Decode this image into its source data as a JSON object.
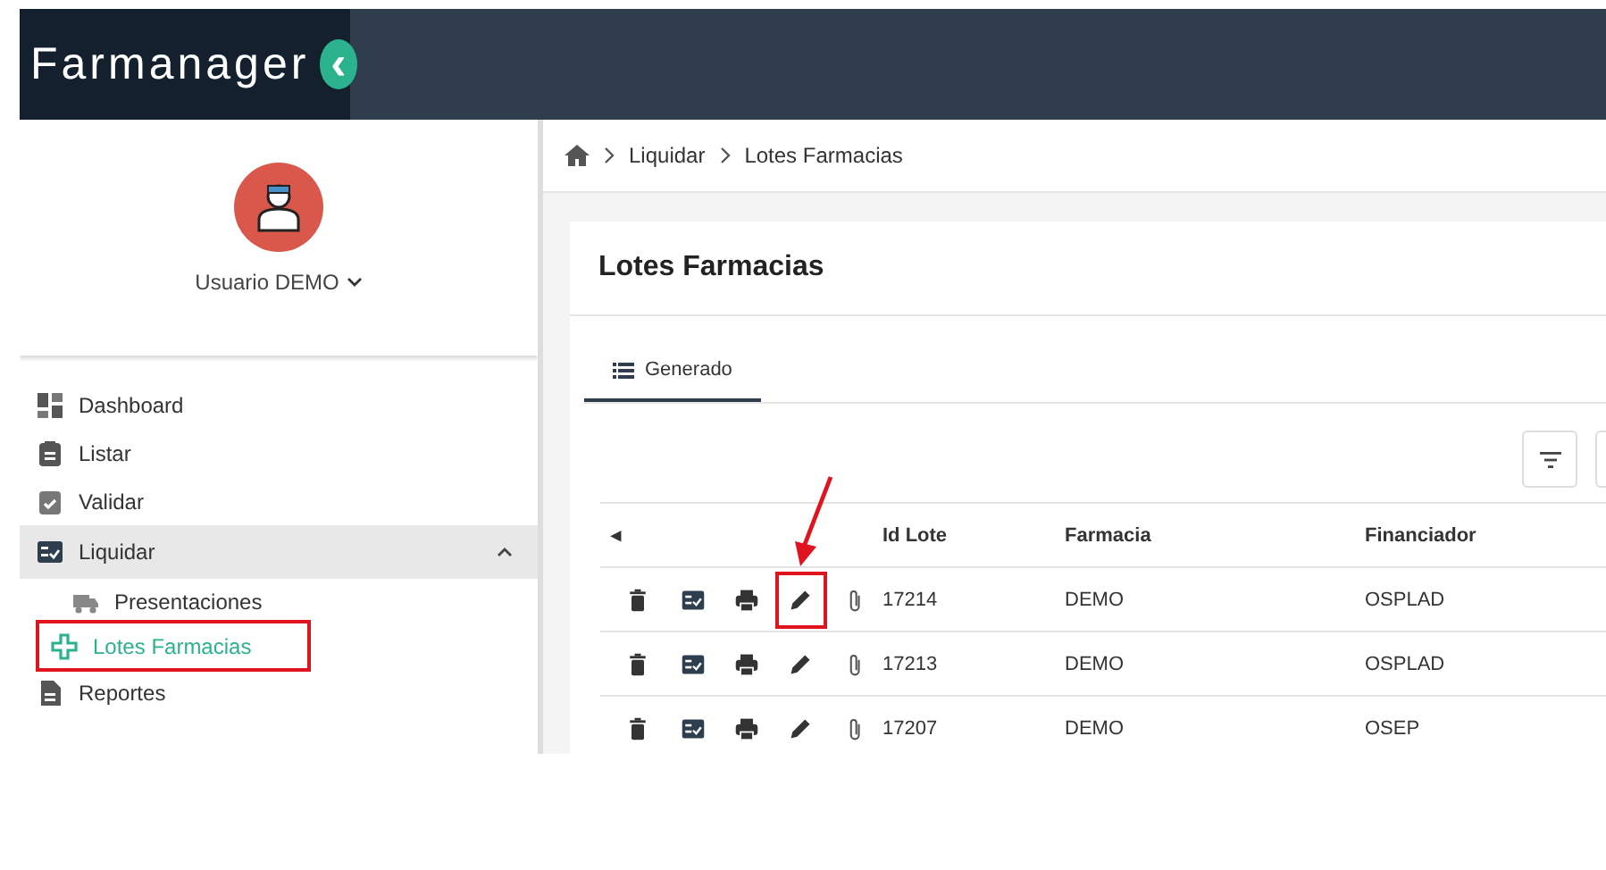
{
  "header": {
    "logo": "Farmanager",
    "collapse_icon": "‹"
  },
  "user": {
    "name": "Usuario DEMO"
  },
  "sidebar": {
    "items": [
      {
        "label": "Dashboard",
        "expanded": false,
        "highlighted": false
      },
      {
        "label": "Listar",
        "expanded": false,
        "highlighted": false
      },
      {
        "label": "Validar",
        "expanded": false,
        "highlighted": false
      },
      {
        "label": "Liquidar",
        "expanded": true,
        "highlighted": false,
        "children": [
          {
            "label": "Presentaciones",
            "selected": false,
            "highlighted": false
          },
          {
            "label": "Lotes Farmacias",
            "selected": true,
            "highlighted": true
          }
        ]
      },
      {
        "label": "Reportes",
        "expanded": false,
        "highlighted": false
      }
    ]
  },
  "breadcrumb": [
    "Liquidar",
    "Lotes Farmacias"
  ],
  "page_title": "Lotes Farmacias",
  "tabs": [
    {
      "label": "Generado",
      "selected": true
    }
  ],
  "table": {
    "sort_icon": "◂",
    "columns": [
      "Id Lote",
      "Farmacia",
      "Financiador"
    ],
    "rows": [
      {
        "cells": [
          "17214",
          "DEMO",
          "OSPLAD"
        ],
        "edit_highlighted": true
      },
      {
        "cells": [
          "17213",
          "DEMO",
          "OSPLAD"
        ],
        "edit_highlighted": false
      },
      {
        "cells": [
          "17207",
          "DEMO",
          "OSEP"
        ],
        "edit_highlighted": false
      }
    ]
  }
}
